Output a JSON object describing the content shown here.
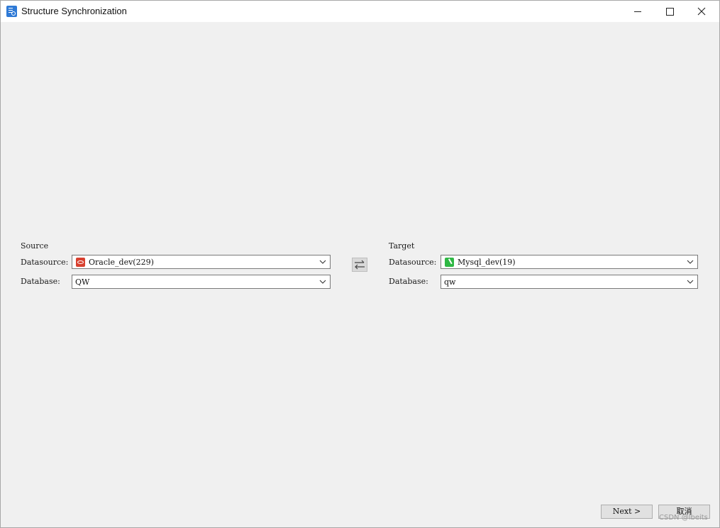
{
  "window": {
    "title": "Structure Synchronization",
    "icon": "structure-sync-icon",
    "controls": {
      "minimize_icon": "minimize-icon",
      "maximize_icon": "maximize-icon",
      "close_icon": "close-icon"
    }
  },
  "source": {
    "heading": "Source",
    "datasource_label": "Datasource:",
    "datasource_value": "Oracle_dev(229)",
    "datasource_icon": "oracle-icon",
    "database_label": "Database:",
    "database_value": "QW"
  },
  "swap": {
    "icon": "swap-arrows-icon"
  },
  "target": {
    "heading": "Target",
    "datasource_label": "Datasource:",
    "datasource_value": "Mysql_dev(19)",
    "datasource_icon": "mysql-icon",
    "database_label": "Database:",
    "database_value": "qw"
  },
  "footer": {
    "next_label": "Next >",
    "cancel_label": "取消",
    "watermark": "CSDN @lbeits"
  },
  "colors": {
    "background": "#f0f0f0",
    "titlebar": "#ffffff",
    "oracle_brand": "#d8402f",
    "mysql_brand": "#2fb844"
  }
}
